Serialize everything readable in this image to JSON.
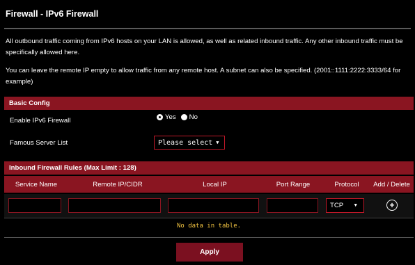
{
  "page": {
    "title": "Firewall - IPv6 Firewall",
    "desc1": "All outbound traffic coming from IPv6 hosts on your LAN is allowed, as well as related inbound traffic. Any other inbound traffic must be specifically allowed here.",
    "desc2": "You can leave the remote IP empty to allow traffic from any remote host. A subnet can also be specified. (2001::1111:2222:3333/64 for example)"
  },
  "basic_config": {
    "title": "Basic Config",
    "enable_label": "Enable IPv6 Firewall",
    "yes_label": "Yes",
    "no_label": "No",
    "selected": "Yes",
    "famous_label": "Famous Server List",
    "famous_value": "Please select",
    "chevron": "▼"
  },
  "rules": {
    "title": "Inbound Firewall Rules (Max Limit : 128)",
    "headers": [
      "Service Name",
      "Remote IP/CIDR",
      "Local IP",
      "Port Range",
      "Protocol",
      "Add / Delete"
    ],
    "protocol_value": "TCP",
    "chevron": "▼",
    "empty_text": "No data in table."
  },
  "actions": {
    "apply_label": "Apply"
  },
  "colors": {
    "accent": "#8a1521",
    "background": "#000000",
    "notice": "#f4c542"
  },
  "icons": {
    "add": "plus-circle-icon",
    "dropdown": "chevron-down-icon"
  }
}
